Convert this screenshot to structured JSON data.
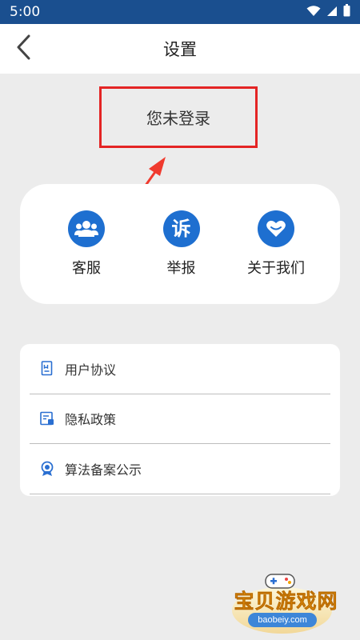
{
  "status_bar": {
    "time": "5:00"
  },
  "header": {
    "title": "设置"
  },
  "login": {
    "text": "您未登录"
  },
  "actions": [
    {
      "label": "客服",
      "icon": "users-icon"
    },
    {
      "label": "举报",
      "icon": "report-icon",
      "glyph": "诉"
    },
    {
      "label": "关于我们",
      "icon": "heart-icon"
    }
  ],
  "list": [
    {
      "label": "用户协议",
      "icon": "document-icon"
    },
    {
      "label": "隐私政策",
      "icon": "privacy-doc-icon"
    },
    {
      "label": "算法备案公示",
      "icon": "badge-icon"
    }
  ],
  "watermark": {
    "title": "宝贝游戏网",
    "url": "baobeiy.com"
  },
  "colors": {
    "status_bar": "#1a4f8f",
    "accent": "#1e6fd0",
    "highlight": "#e42424",
    "background": "#ececec"
  }
}
